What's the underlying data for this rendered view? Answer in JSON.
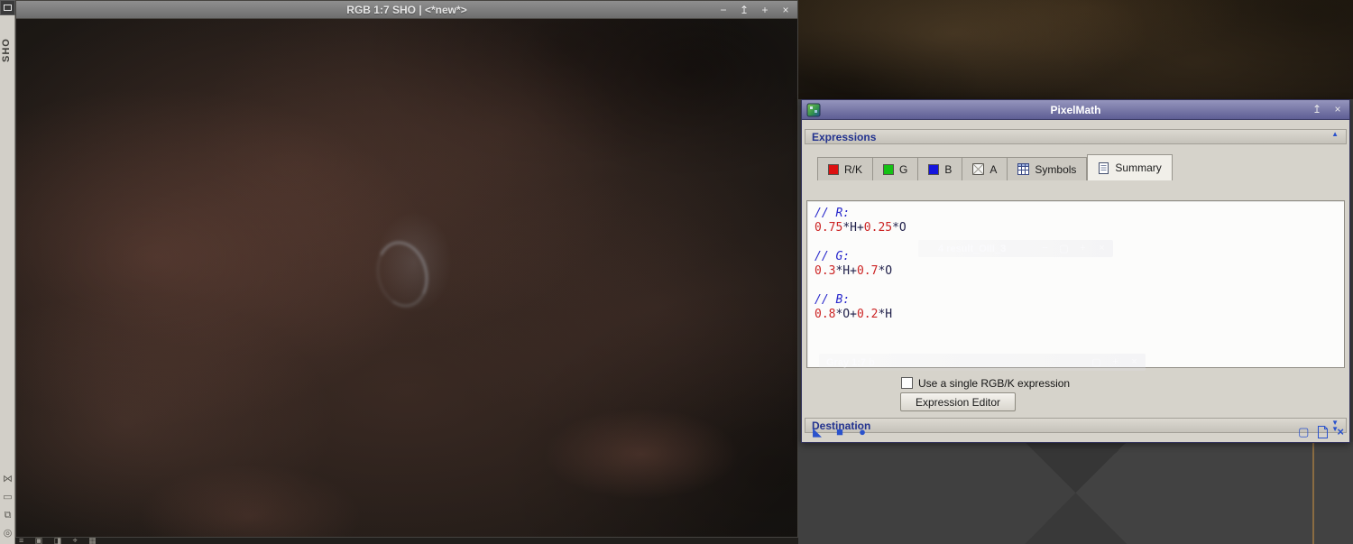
{
  "left_rail": {
    "workspace_label": "SHO",
    "bottom_icons": [
      "⋈",
      "▭",
      "⧉",
      "◎"
    ]
  },
  "image_window": {
    "title": "RGB 1:7 SHO | <*new*>",
    "controls": {
      "minimize": "−",
      "shade": "↥",
      "zoom": "+",
      "close": "×"
    },
    "status_icons": [
      "≡",
      "▣",
      "◨",
      "⌖",
      "▦"
    ]
  },
  "pixelmath": {
    "title": "PixelMath",
    "controls": {
      "shade": "↥",
      "close": "×"
    },
    "sections": {
      "expressions": "Expressions",
      "destination": "Destination"
    },
    "tabs": [
      {
        "label": "R/K",
        "icon": "red-channel"
      },
      {
        "label": "G",
        "icon": "green-channel"
      },
      {
        "label": "B",
        "icon": "blue-channel"
      },
      {
        "label": "A",
        "icon": "alpha-channel"
      },
      {
        "label": "Symbols",
        "icon": "symbols-grid"
      },
      {
        "label": "Summary",
        "icon": "summary-page"
      }
    ],
    "active_tab": "Summary",
    "editor_lines": [
      [
        {
          "t": "// R:",
          "k": "c"
        }
      ],
      [
        {
          "t": "0.75",
          "k": "n"
        },
        {
          "t": "*H+",
          "k": "o"
        },
        {
          "t": "0.25",
          "k": "n"
        },
        {
          "t": "*O",
          "k": "o"
        }
      ],
      [],
      [
        {
          "t": "// G:",
          "k": "c"
        }
      ],
      [
        {
          "t": "0.3",
          "k": "n"
        },
        {
          "t": "*H+",
          "k": "o"
        },
        {
          "t": "0.7",
          "k": "n"
        },
        {
          "t": "*O",
          "k": "o"
        }
      ],
      [],
      [
        {
          "t": "// B:",
          "k": "c"
        }
      ],
      [
        {
          "t": "0.8",
          "k": "n"
        },
        {
          "t": "*O+",
          "k": "o"
        },
        {
          "t": "0.2",
          "k": "n"
        },
        {
          "t": "*H",
          "k": "o"
        }
      ]
    ],
    "single_rgbk_label": "Use a single RGB/K expression",
    "single_rgbk_checked": false,
    "expression_editor_button": "Expression Editor",
    "toolbar": {
      "new_instance": "◣",
      "apply": "■",
      "apply_global": "●",
      "browse_doc": "▢",
      "reset": "×"
    },
    "chevrons": {
      "up": "▲",
      "down": "▼"
    }
  },
  "ghost_windows": [
    {
      "title": "4 result_OIII_3",
      "buttons": [
        "−",
        "▢",
        "+",
        "×"
      ]
    },
    {
      "title": "Gray 1:7 b",
      "buttons": [
        "▢",
        "+",
        "×"
      ]
    }
  ],
  "colors": {
    "section_label": "#23338f",
    "icon_blue": "#2a52cc",
    "comment": "#2929cc",
    "number": "#cc2424",
    "orange_guide": "#8a6c42"
  }
}
